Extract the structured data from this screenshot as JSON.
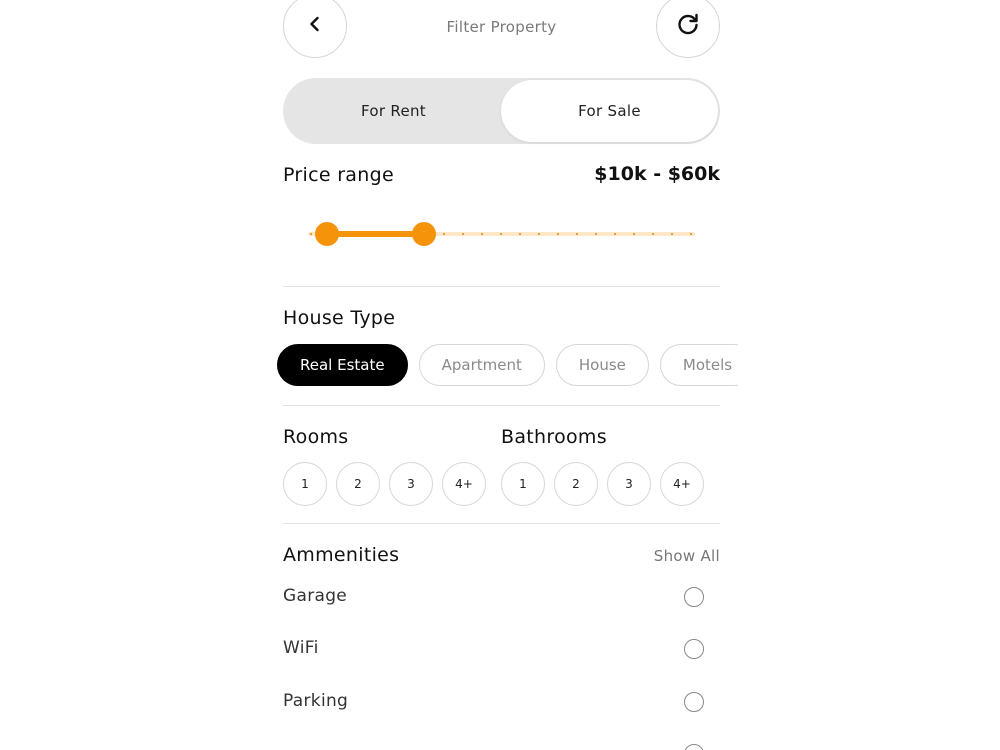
{
  "header": {
    "title": "Filter Property",
    "back_icon": "chevron-left-icon",
    "refresh_icon": "refresh-icon"
  },
  "listing_toggle": {
    "options": [
      "For Rent",
      "For Sale"
    ],
    "selected": "For Sale"
  },
  "price": {
    "label": "Price range",
    "value": "$10k - $60k",
    "slider_low_fraction": 0.05,
    "slider_high_fraction": 0.3,
    "accent_color": "#F5930A"
  },
  "house_type": {
    "title": "House Type",
    "options": [
      "Real Estate",
      "Apartment",
      "House",
      "Motels"
    ],
    "selected": "Real Estate"
  },
  "rooms": {
    "title": "Rooms",
    "options": [
      "1",
      "2",
      "3",
      "4+"
    ]
  },
  "bathrooms": {
    "title": "Bathrooms",
    "options": [
      "1",
      "2",
      "3",
      "4+"
    ]
  },
  "amenities": {
    "title": "Ammenities",
    "show_all": "Show All",
    "items": [
      "Garage",
      "WiFi",
      "Parking"
    ]
  }
}
